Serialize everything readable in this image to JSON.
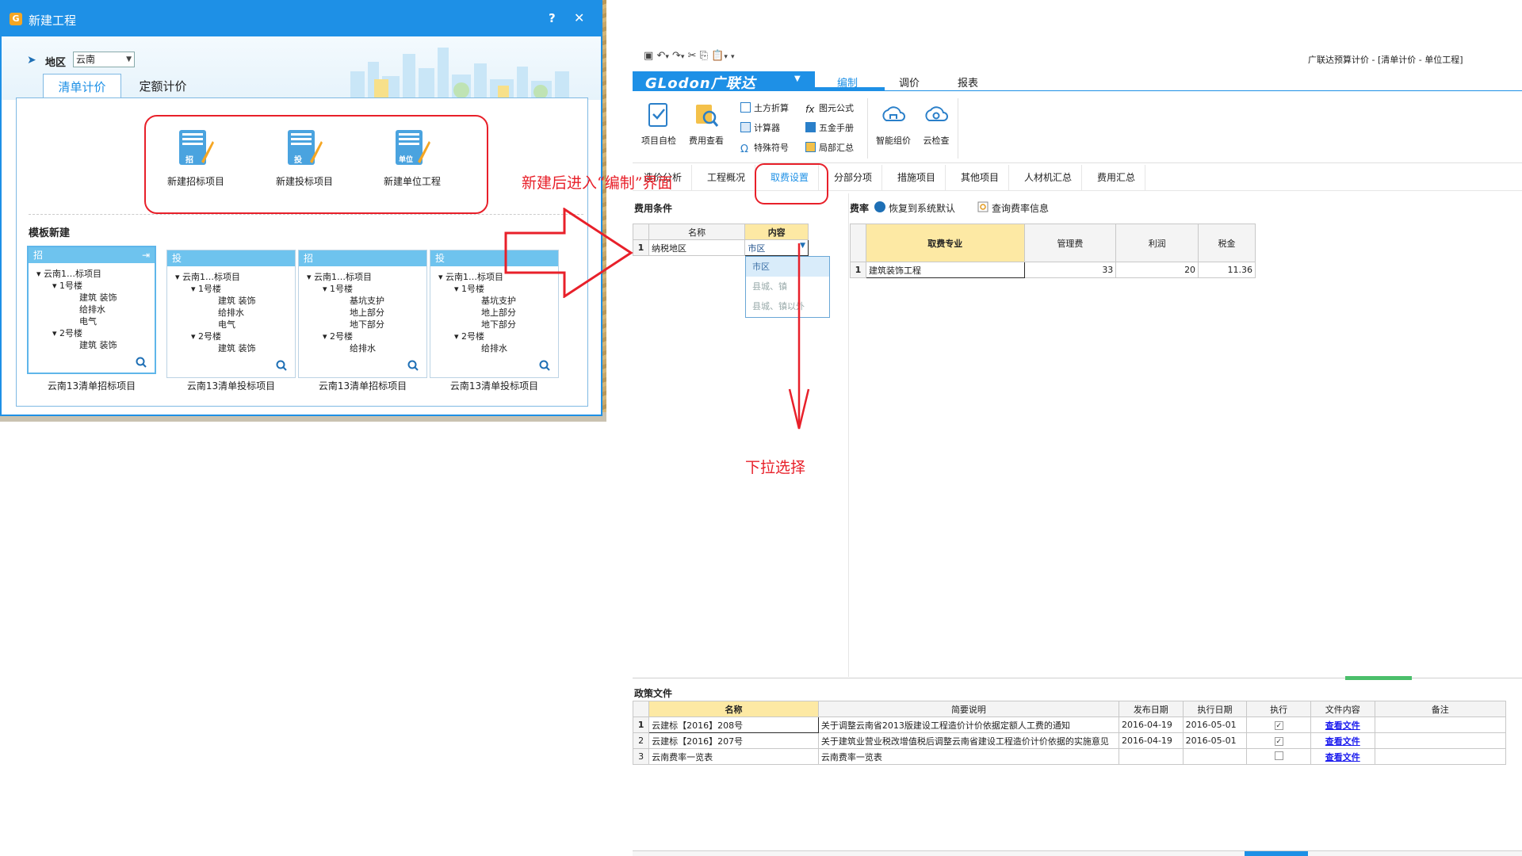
{
  "dialog": {
    "title": "新建工程",
    "help": "?",
    "close": "✕",
    "region_label": "地区",
    "region_value": "云南",
    "tabs": [
      {
        "label": "清单计价"
      },
      {
        "label": "定额计价"
      }
    ],
    "new_items": [
      {
        "label": "新建招标项目",
        "badge": "招"
      },
      {
        "label": "新建投标项目",
        "badge": "投"
      },
      {
        "label": "新建单位工程",
        "badge": "单位"
      }
    ],
    "template_title": "模板新建",
    "templates": [
      {
        "badge": "招",
        "name": "云南13清单招标项目",
        "tree": [
          "▾ 云南1…标项目",
          "▾ 1号楼",
          "建筑 装饰",
          "给排水",
          "电气",
          "▾ 2号楼",
          "建筑 装饰"
        ]
      },
      {
        "badge": "投",
        "name": "云南13清单投标项目",
        "tree": [
          "▾ 云南1…标项目",
          "▾ 1号楼",
          "建筑 装饰",
          "给排水",
          "电气",
          "▾ 2号楼",
          "建筑 装饰"
        ]
      },
      {
        "badge": "招",
        "name": "云南13清单招标项目",
        "tree": [
          "▾ 云南1…标项目",
          "▾ 1号楼",
          "基坑支护",
          "地上部分",
          "地下部分",
          "▾ 2号楼",
          "给排水"
        ]
      },
      {
        "badge": "投",
        "name": "云南13清单投标项目",
        "tree": [
          "▾ 云南1…标项目",
          "▾ 1号楼",
          "基坑支护",
          "地上部分",
          "地下部分",
          "▾ 2号楼",
          "给排水"
        ]
      }
    ]
  },
  "app": {
    "title": "广联达预算计价 - [清单计价 - 单位工程]",
    "brand": "GLodon广联达",
    "ribbon_tabs": [
      {
        "label": "编制"
      },
      {
        "label": "调价"
      },
      {
        "label": "报表"
      }
    ],
    "ribbon": {
      "project_check": "项目自检",
      "fee_view": "费用查看",
      "earthwork": "土方折算",
      "calculator": "计算器",
      "special_symbol": "特殊符号",
      "formula": "图元公式",
      "hardware_manual": "五金手册",
      "partial_summary": "局部汇总",
      "smart_price": "智能组价",
      "cloud_check": "云检查"
    },
    "page_tabs": [
      {
        "label": "造价分析"
      },
      {
        "label": "工程概况"
      },
      {
        "label": "取费设置"
      },
      {
        "label": "分部分项"
      },
      {
        "label": "措施项目"
      },
      {
        "label": "其他项目"
      },
      {
        "label": "人材机汇总"
      },
      {
        "label": "费用汇总"
      }
    ],
    "fee_conditions": {
      "label": "费用条件",
      "headers": {
        "name": "名称",
        "content": "内容"
      },
      "row": {
        "num": "1",
        "name": "纳税地区",
        "content": "市区"
      },
      "dropdown_options": [
        "市区",
        "县城、镇",
        "县城、镇以外"
      ]
    },
    "fee_rate": {
      "label": "费率",
      "restore": "恢复到系统默认",
      "query": "查询费率信息",
      "headers": {
        "specialty": "取费专业",
        "mgmt": "管理费",
        "profit": "利润",
        "tax": "税金"
      },
      "row": {
        "num": "1",
        "specialty": "建筑装饰工程",
        "mgmt": "33",
        "profit": "20",
        "tax": "11.36"
      }
    },
    "policy": {
      "label": "政策文件",
      "headers": {
        "name": "名称",
        "desc": "简要说明",
        "publish": "发布日期",
        "effective": "执行日期",
        "execute": "执行",
        "content": "文件内容",
        "note": "备注"
      },
      "rows": [
        {
          "num": "1",
          "name": "云建标【2016】208号",
          "desc": "关于调整云南省2013版建设工程造价计价依据定额人工费的通知",
          "publish": "2016-04-19",
          "effective": "2016-05-01",
          "checked": "✓",
          "link": "查看文件"
        },
        {
          "num": "2",
          "name": "云建标【2016】207号",
          "desc": "关于建筑业营业税改增值税后调整云南省建设工程造价计价依据的实施意见",
          "publish": "2016-04-19",
          "effective": "2016-05-01",
          "checked": "✓",
          "link": "查看文件"
        },
        {
          "num": "3",
          "name": "云南费率一览表",
          "desc": "云南费率一览表",
          "publish": "",
          "effective": "",
          "checked": "",
          "link": "查看文件"
        }
      ]
    }
  },
  "annotations": {
    "enter_edit": "新建后进入“编制”界面",
    "dropdown_select": "下拉选择"
  },
  "colors": {
    "accent": "#1e90e6",
    "annotation": "#e8202a",
    "header_highlight": "#fde9a4"
  }
}
